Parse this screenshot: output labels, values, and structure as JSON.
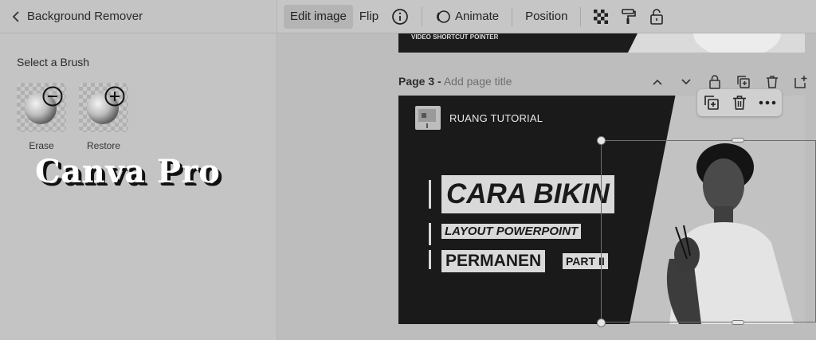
{
  "sidebar": {
    "back_label": "Background Remover",
    "brush_title": "Select a Brush",
    "brushes": [
      {
        "label": "Erase",
        "icon": "minus-circle-icon"
      },
      {
        "label": "Restore",
        "icon": "plus-circle-icon"
      }
    ]
  },
  "watermark": "Canva Pro",
  "toolbar": {
    "edit_image": "Edit image",
    "flip": "Flip",
    "info_icon": "info-icon",
    "animate": "Animate",
    "position": "Position",
    "transparency_icon": "transparency-icon",
    "paint_roller_icon": "paint-roller-icon",
    "lock_icon": "lock-icon"
  },
  "prev_page": {
    "text": "VIDEO SHORTCUT POINTER"
  },
  "page": {
    "label": "Page 3 -",
    "title_placeholder": "Add page title",
    "controls": [
      "chevron-up-icon",
      "chevron-down-icon",
      "lock-icon",
      "duplicate-page-icon",
      "delete-page-icon",
      "add-page-icon"
    ]
  },
  "slide": {
    "brand": "RUANG TUTORIAL",
    "line1": "CARA BIKIN",
    "line2": "LAYOUT POWERPOINT",
    "line3": "PERMANEN",
    "line4": "PART II"
  },
  "float_tools": [
    "duplicate-icon",
    "trash-icon",
    "more-icon"
  ],
  "colors": {
    "slide_bg": "#1a1a1a",
    "text_pill": "#d9d9d9",
    "panel_bg": "#c4c4c4"
  }
}
